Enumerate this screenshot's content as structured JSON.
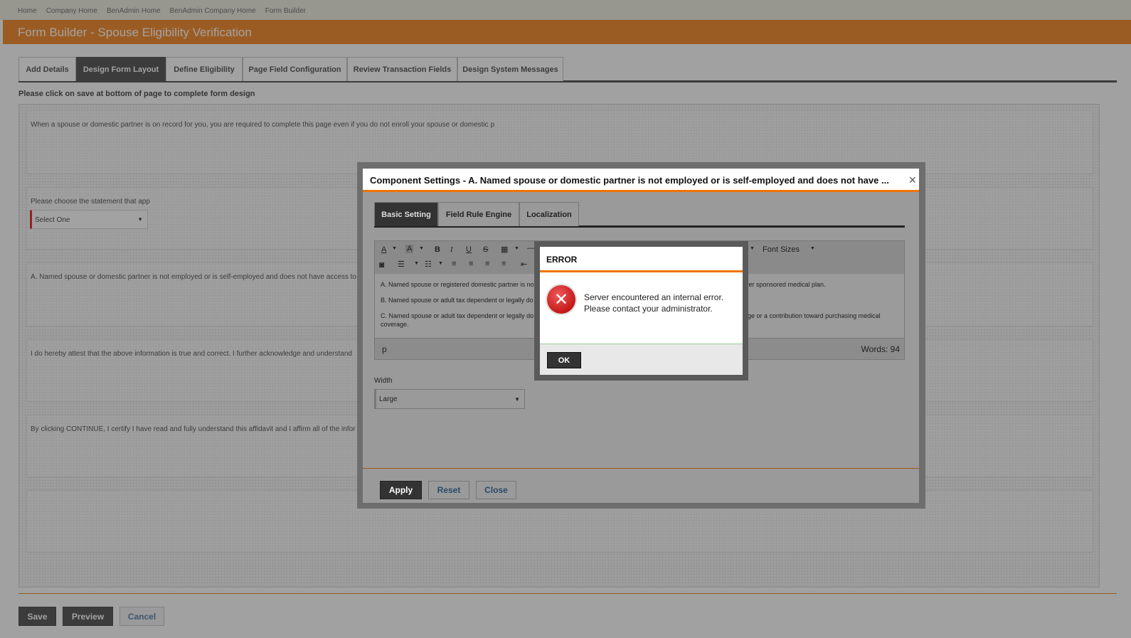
{
  "breadcrumb": [
    "Home",
    "Company Home",
    "BenAdmin Home",
    "BenAdmin Company Home",
    "Form Builder"
  ],
  "page_title": "Form Builder - Spouse Eligibility Verification",
  "tabs": [
    {
      "label": "Add Details",
      "active": false
    },
    {
      "label": "Design Form Layout",
      "active": true
    },
    {
      "label": "Define Eligibility",
      "active": false
    },
    {
      "label": "Page Field Configuration",
      "active": false
    },
    {
      "label": "Review Transaction Fields",
      "active": false
    },
    {
      "label": "Design System Messages",
      "active": false
    }
  ],
  "notice": "Please click on save at bottom of page to complete form design",
  "blocks": {
    "b1": "When a spouse or domestic partner is on record for you, you are required to complete this page even if you do not enroll your spouse or domestic p",
    "b2": "Please choose the statement that app",
    "b2_select": "Select One",
    "b3": "A. Named spouse or domestic partner is not employed or is self-employed and does not have access to",
    "b4": "I do hereby attest that the above information is true and correct. I further acknowledge and understand",
    "b5": "By clicking CONTINUE, I certify I have read and fully understand this affidavit and I affirm all of the infor"
  },
  "footer_buttons": {
    "save": "Save",
    "preview": "Preview",
    "cancel": "Cancel"
  },
  "settings_dialog": {
    "title": "Component Settings - A. Named spouse or domestic partner is not employed or is self-employed and does not have ...",
    "close": "×",
    "tabs": [
      "Basic Setting",
      "Field Rule Engine",
      "Localization"
    ],
    "toolbar": {
      "font_color": "A",
      "bg_color": "A",
      "bold": "B",
      "italic": "I",
      "underline": "U",
      "strike": "S",
      "font_sizes": "Font Sizes"
    },
    "editor_lines": {
      "a_left": "A. Named spouse or registered domestic partner is no",
      "a_right": "oyer sponsored medical plan.",
      "b_left": "B. Named spouse or adult tax dependent or legally do",
      "c_left": "C. Named spouse or adult tax dependent or legally do",
      "c_right": "rage or a contribution toward purchasing medical",
      "c_wrap": "coverage."
    },
    "status_path": "p",
    "word_count": "Words: 94",
    "width_label": "Width",
    "width_value": "Large",
    "buttons": {
      "apply": "Apply",
      "reset": "Reset",
      "close": "Close"
    }
  },
  "error_dialog": {
    "title": "ERROR",
    "message": "Server encountered an internal error. Please contact your administrator.",
    "ok": "OK"
  }
}
